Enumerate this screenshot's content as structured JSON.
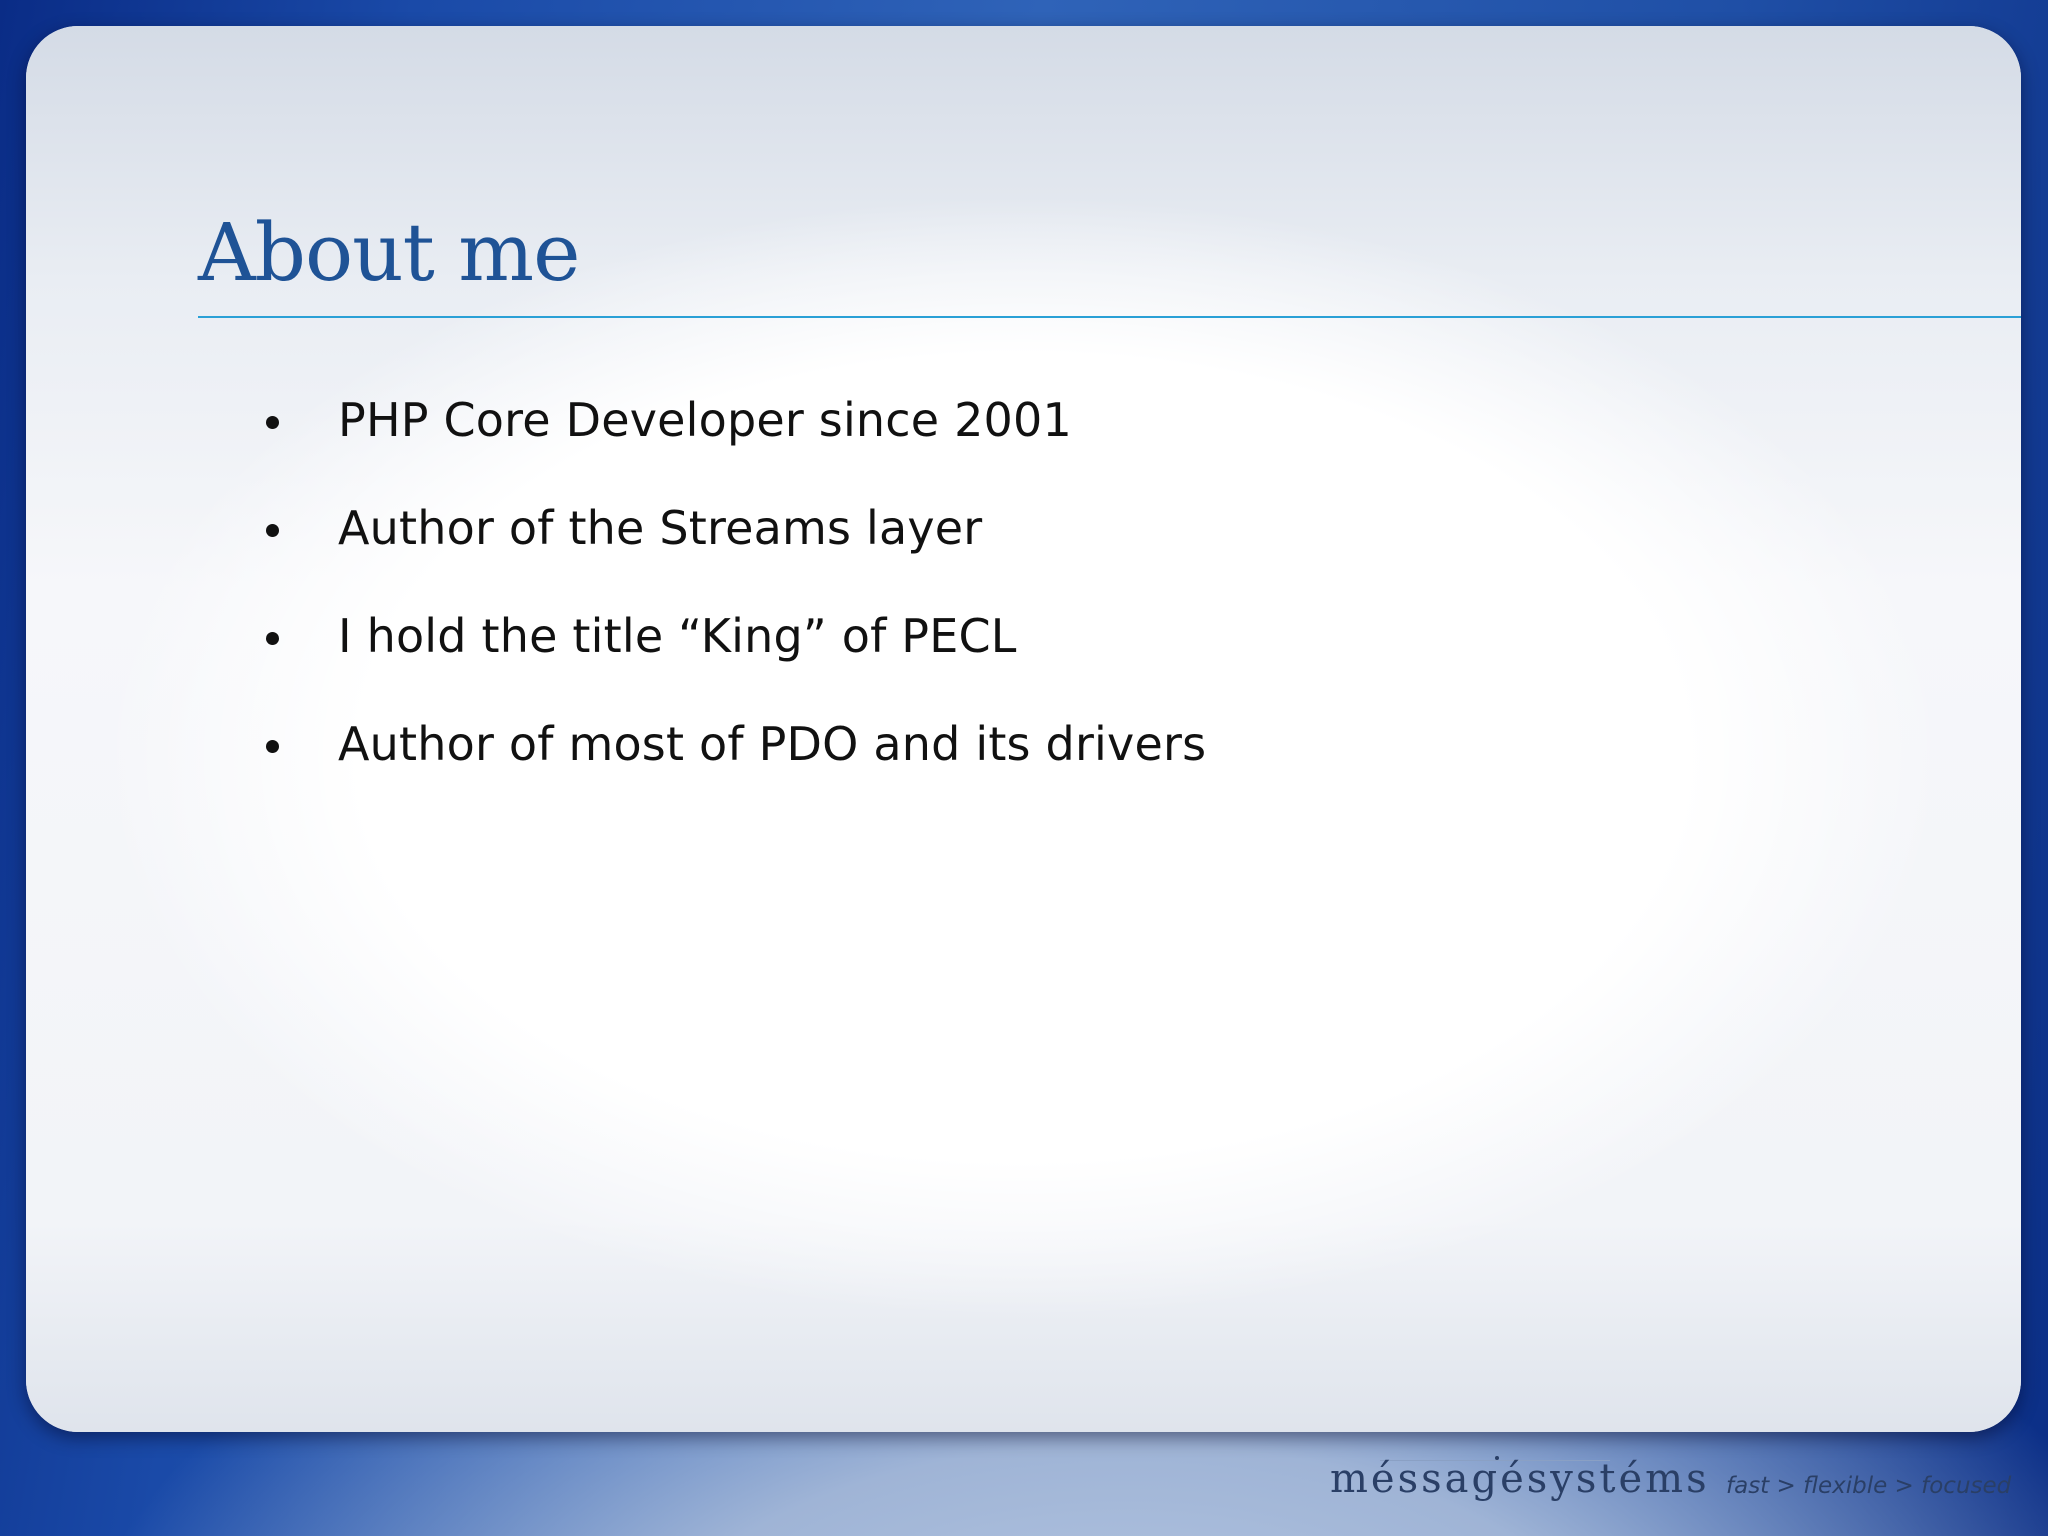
{
  "slide": {
    "title": "About me",
    "bullets": [
      {
        "text": "PHP Core Developer since 2001"
      },
      {
        "text": "Author of the Streams layer"
      },
      {
        "text": "I hold the title “King” of PECL"
      },
      {
        "text": "Author of most of PDO and its drivers"
      }
    ]
  },
  "footer": {
    "logo": "méssagésystéms",
    "tagline": "fast > flexible > focused"
  },
  "colors": {
    "title": "#1f5396",
    "rule": "#2aa0d6",
    "background_blue": "#1a4aa8"
  }
}
